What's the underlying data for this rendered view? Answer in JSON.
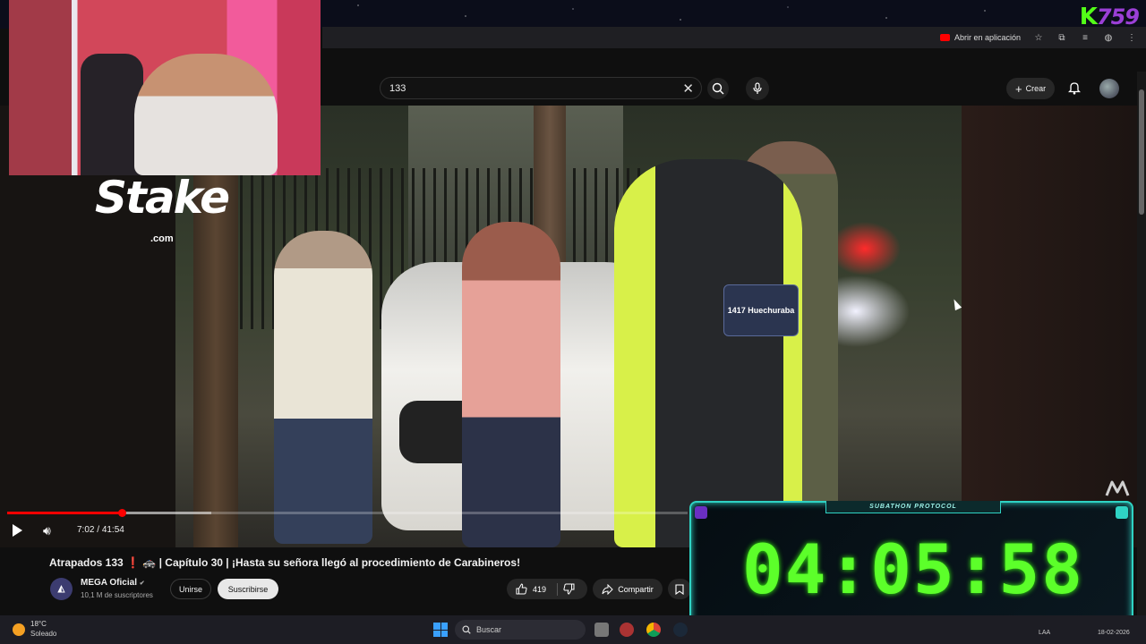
{
  "browser": {
    "open_in_app_label": "Abrir en aplicación"
  },
  "overlay": {
    "kick_logo_letter": "K",
    "kick_logo_number": "759",
    "stake_logo": "Stake",
    "stake_domain": ".com",
    "subathon_label": "SUBATHON PROTOCOL",
    "timer": "04:05:58"
  },
  "youtube": {
    "search": {
      "value": "133"
    },
    "create_label": "Crear",
    "player": {
      "time_current": "7:02",
      "time_separator": " / ",
      "time_total": "41:54",
      "progress_fraction": 0.168,
      "buffer_fraction": 0.3
    },
    "video": {
      "title": "Atrapados 133 ❗ 🚓 | Capítulo 30 | ¡Hasta su señora llegó al procedimiento de Carabineros!",
      "badge_text": "1417 Huechuraba"
    },
    "channel": {
      "name": "MEGA Oficial",
      "verified": "✔",
      "subscribers": "10,1 M de suscriptores",
      "join_label": "Unirse",
      "subscribe_label": "Suscribirse"
    },
    "actions": {
      "likes": "419",
      "share_label": "Compartir"
    }
  },
  "taskbar": {
    "temperature": "18°C",
    "condition": "Soleado",
    "search_label": "Buscar",
    "language": "LAA",
    "date": "18-02-2026"
  },
  "colors": {
    "timer_green": "#5cff2a",
    "timer_frame": "#2fd3c4",
    "youtube_red": "#ff0000",
    "kick_green": "#53fc18"
  }
}
